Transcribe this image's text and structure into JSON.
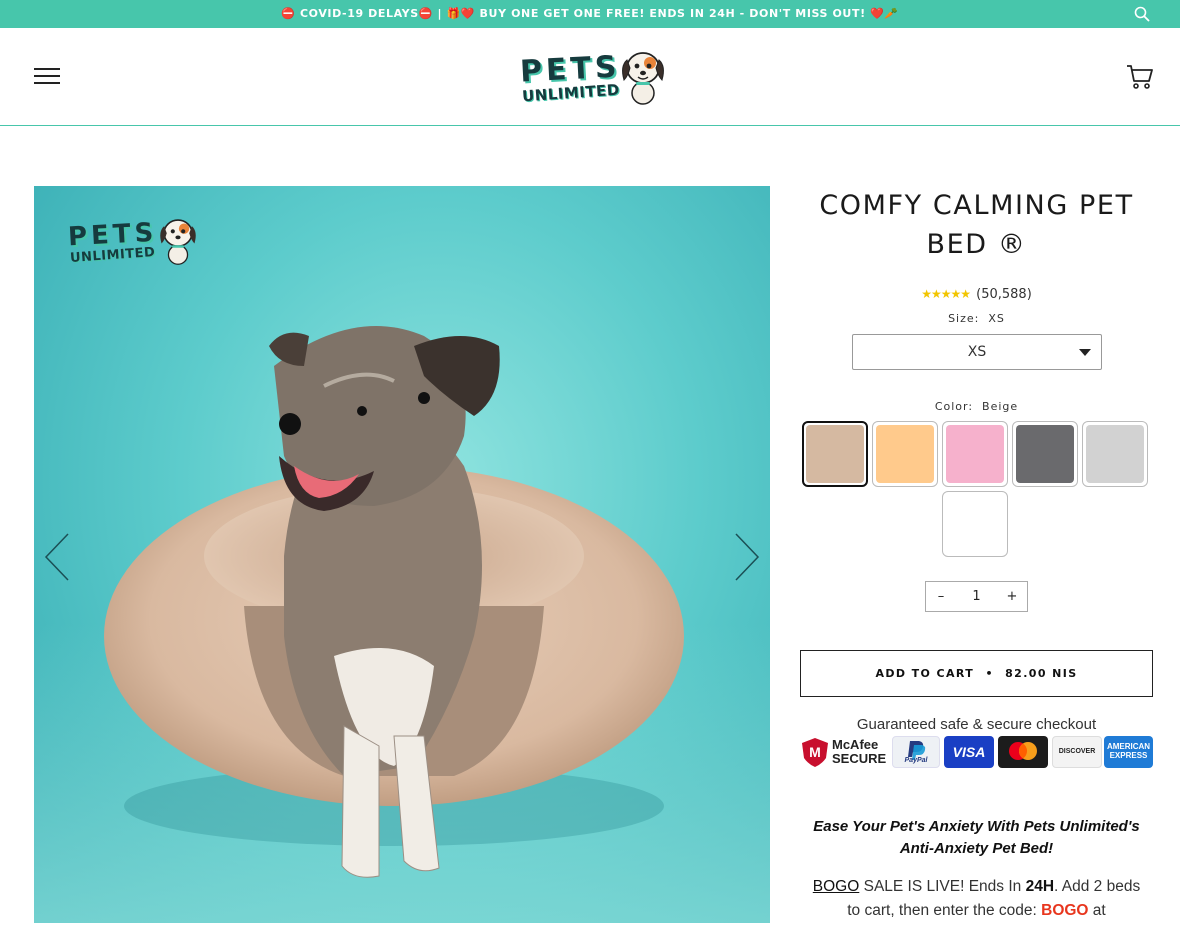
{
  "announcement": {
    "text": "⛔ COVID-19 DELAYS⛔ | 🎁❤️ BUY ONE GET ONE FREE! ENDS IN 24H - DON'T MISS OUT! ❤️🥕"
  },
  "header": {
    "logo_top": "PETS",
    "logo_bottom": "UNLIMITED",
    "icons": [
      "menu-icon",
      "cart-icon",
      "search-icon"
    ]
  },
  "gallery": {
    "watermark_top": "PETS",
    "watermark_bottom": "UNLIMITED"
  },
  "product": {
    "title": "COMFY CALMING PET BED ®",
    "stars": "★★★★★",
    "review_count": "(50,588)",
    "size_label": "Size:",
    "size_value": "XS",
    "size_selected": "XS",
    "color_label": "Color:",
    "color_value": "Beige",
    "swatches": [
      {
        "name": "Beige",
        "color": "#d5b9a1",
        "selected": true
      },
      {
        "name": "Orange",
        "color": "#ffca8c",
        "selected": false
      },
      {
        "name": "Pink",
        "color": "#f6b1cc",
        "selected": false
      },
      {
        "name": "Dark Gray",
        "color": "#6a6a6d",
        "selected": false
      },
      {
        "name": "Light Gray",
        "color": "#d2d2d2",
        "selected": false
      },
      {
        "name": "White",
        "color": "#ffffff",
        "selected": false
      }
    ],
    "quantity": "1",
    "qty_minus": "–",
    "qty_plus": "+",
    "add_to_cart": "ADD TO CART",
    "separator": "•",
    "price": "82.00 NIS",
    "secure_text": "Guaranteed safe & secure checkout",
    "badges": {
      "mcafee_1": "McAfee",
      "mcafee_2": "SECURE",
      "paypal": "PayPal",
      "visa": "VISA",
      "discover": "DISCOVER",
      "amex_1": "AMERICAN",
      "amex_2": "EXPRESS"
    },
    "desc_line1": "Ease Your Pet's Anxiety With Pets Unlimited's",
    "desc_line2": "Anti-Anxiety Pet Bed!",
    "bogo_word": "BOGO",
    "bogo_text1": " SALE IS LIVE! Ends In ",
    "bogo_24h": "24H",
    "bogo_text2": ". Add 2 beds",
    "bogo_text3": "to cart, then enter the code: ",
    "bogo_code": "BOGO",
    "bogo_text4": " at"
  },
  "colors": {
    "accent": "#47c6ab",
    "brand_dark": "#163b3e",
    "promo_red": "#e8361e"
  }
}
